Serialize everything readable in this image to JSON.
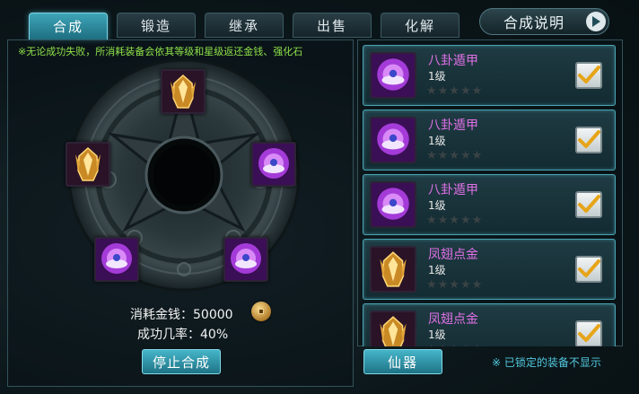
{
  "tabs": [
    {
      "label": "合成",
      "active": true
    },
    {
      "label": "锻造",
      "active": false
    },
    {
      "label": "继承",
      "active": false
    },
    {
      "label": "出售",
      "active": false
    },
    {
      "label": "化解",
      "active": false
    }
  ],
  "help_button": {
    "label": "合成说明",
    "icon": "play-arrow-icon"
  },
  "notice": "※无论成功失败，所消耗装备会依其等级和星级返还金钱、强化石",
  "slots": [
    {
      "icon": "golden-helmet-icon"
    },
    {
      "icon": "golden-helmet-icon"
    },
    {
      "icon": "purple-orb-icon"
    },
    {
      "icon": "purple-orb-icon"
    },
    {
      "icon": "purple-orb-icon"
    }
  ],
  "cost": {
    "label": "消耗金钱：",
    "value": "50000",
    "icon": "gold-coin-icon"
  },
  "rate": {
    "label": "成功几率：",
    "value": "40%"
  },
  "stop_button": "停止合成",
  "items": [
    {
      "name": "八卦遁甲",
      "level": "1级",
      "icon": "purple-orb-icon",
      "stars": 0,
      "max_stars": 5,
      "checked": true
    },
    {
      "name": "八卦遁甲",
      "level": "1级",
      "icon": "purple-orb-icon",
      "stars": 0,
      "max_stars": 5,
      "checked": true
    },
    {
      "name": "八卦遁甲",
      "level": "1级",
      "icon": "purple-orb-icon",
      "stars": 0,
      "max_stars": 5,
      "checked": true
    },
    {
      "name": "凤翅点金",
      "level": "1级",
      "icon": "golden-helmet-icon",
      "stars": 0,
      "max_stars": 5,
      "checked": true
    },
    {
      "name": "凤翅点金",
      "level": "1级",
      "icon": "golden-helmet-icon",
      "stars": 0,
      "max_stars": 5,
      "checked": true
    }
  ],
  "category_button": "仙器",
  "lock_note": "※ 已锁定的装备不显示",
  "colors": {
    "accent": "#3fa5b8",
    "notice_text": "#8fe14a",
    "item_name": "#e070e6",
    "lock_note": "#52c8de",
    "check": "#e6a419"
  }
}
